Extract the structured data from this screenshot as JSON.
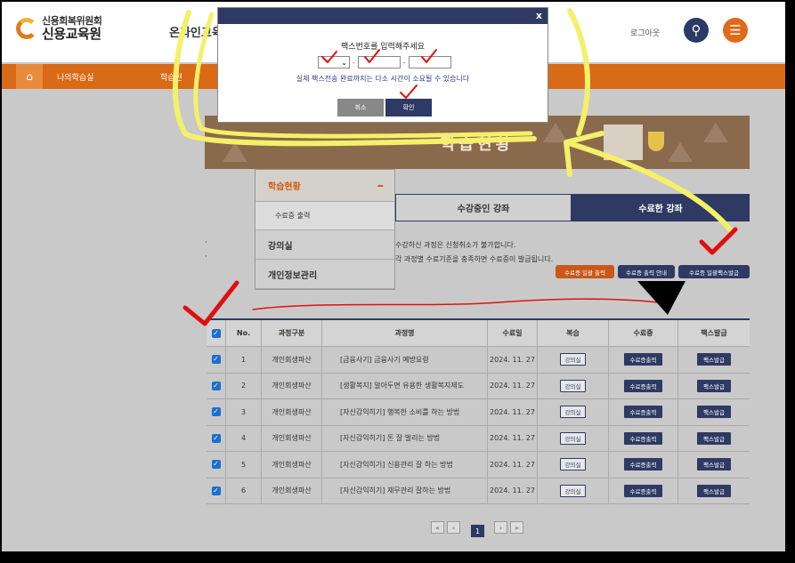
{
  "header": {
    "logo_line1": "신용회복위원회",
    "logo_line2": "신용교육원",
    "site_label": "온라인교육",
    "logout": "로그아웃"
  },
  "nav": {
    "item1": "나의학습실",
    "item2": "학습현"
  },
  "banner": {
    "title": "학습현황"
  },
  "side_menu": {
    "head": "학습현황",
    "sub": "수료증 출력",
    "items": [
      "강의실",
      "개인정보관리"
    ]
  },
  "tabs": {
    "current": "수강중인 강좌",
    "completed": "수료한 강좌"
  },
  "notices": [
    "수강하신 과정은 신청취소가 불가합니다.",
    "각 과정별 수료기준을 충족하면 수료증이 발급됩니다."
  ],
  "actions": {
    "bulk_print": "수료증 일괄 출력",
    "print_guide": "수료증 출력 안내",
    "bulk_fax": "수료증 일괄팩스발급"
  },
  "table": {
    "headers": [
      "No.",
      "과정구분",
      "과정명",
      "수료일",
      "복습",
      "수료증",
      "팩스발급"
    ],
    "rows": [
      {
        "no": "1",
        "type": "개인회생파산",
        "name": "[금융사기] 금융사기 예방요령",
        "date": "2024. 11. 27",
        "review": "강의실",
        "cert": "수료증출력",
        "fax": "팩스발급"
      },
      {
        "no": "2",
        "type": "개인회생파산",
        "name": "[생활복지] 알아두면 유용한 생활복지제도",
        "date": "2024. 11. 27",
        "review": "강의실",
        "cert": "수료증출력",
        "fax": "팩스발급"
      },
      {
        "no": "3",
        "type": "개인회생파산",
        "name": "[자신감익히기] 행복한 소비를 하는 방법",
        "date": "2024. 11. 27",
        "review": "강의실",
        "cert": "수료증출력",
        "fax": "팩스발급"
      },
      {
        "no": "4",
        "type": "개인회생파산",
        "name": "[자신감익히기] 돈 잘 벌리는 방법",
        "date": "2024. 11. 27",
        "review": "강의실",
        "cert": "수료증출력",
        "fax": "팩스발급"
      },
      {
        "no": "5",
        "type": "개인회생파산",
        "name": "[자신감익히기] 신용관리 잘 하는 방법",
        "date": "2024. 11. 27",
        "review": "강의실",
        "cert": "수료증출력",
        "fax": "팩스발급"
      },
      {
        "no": "6",
        "type": "개인회생파산",
        "name": "[자신감익히기] 재무관리 잘하는 방법",
        "date": "2024. 11. 27",
        "review": "강의실",
        "cert": "수료증출력",
        "fax": "팩스발급"
      }
    ]
  },
  "pagination": {
    "current": "1"
  },
  "modal": {
    "close": "x",
    "title": "팩스번호를 입력해주세요",
    "note": "실제 팩스전송 완료까지는 다소 시간이 소요될 수 있습니다",
    "cancel": "취소",
    "ok": "확인"
  },
  "colors": {
    "navy": "#2e3a63",
    "orange": "#d96a16",
    "annotation_yellow": "#f4f06a",
    "annotation_red": "#e01010"
  }
}
